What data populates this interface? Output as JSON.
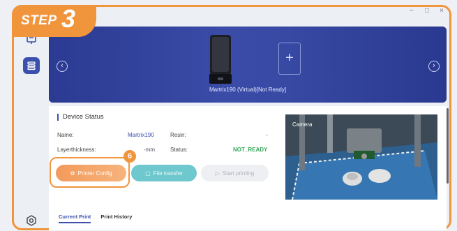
{
  "step": {
    "word": "STEP",
    "number": "3"
  },
  "window_controls": {
    "minimize": "−",
    "maximize": "□",
    "close": "×"
  },
  "banner": {
    "prev_arrow": "‹",
    "next_arrow": "›",
    "add_symbol": "+",
    "printer_label": "Martrix190 (Virtual)[Not Ready]"
  },
  "device_status": {
    "title": "Device Status",
    "name_label": "Name:",
    "name_value": "Martrix190",
    "resin_label": "Resin:",
    "resin_value": "-",
    "layer_label": "Layerthickness:",
    "layer_value": "-mm",
    "status_label": "Status:",
    "status_value": "NOT_READY"
  },
  "buttons": {
    "printer_config": "Printer Config",
    "file_transfer": "File transfer",
    "start_printing": "Start printing"
  },
  "callout_badge": "6",
  "camera_label": "Camera",
  "tabs": {
    "current": "Current Print",
    "history": "Print History"
  },
  "colors": {
    "accent": "#f1953d",
    "primary": "#2c3a8f",
    "teal": "#6ec8cd",
    "status_green": "#3aa65a"
  }
}
